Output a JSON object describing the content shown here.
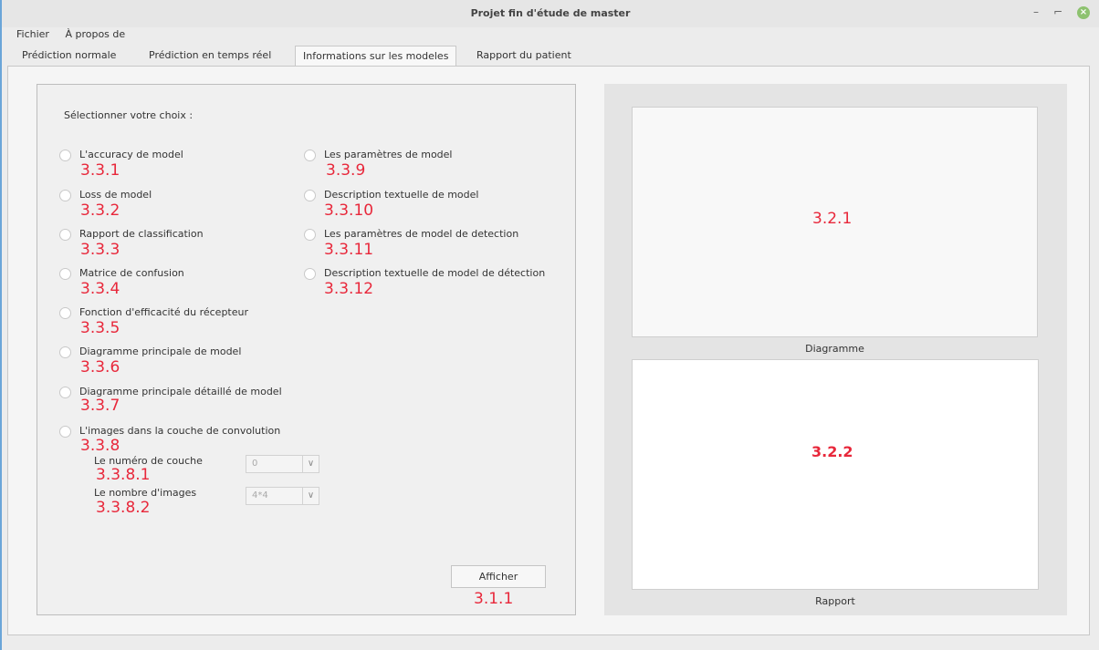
{
  "window": {
    "title": "Projet fin d'étude de master",
    "min": "–",
    "restore": "⌐",
    "close": "×"
  },
  "menu": [
    "Fichier",
    "À propos de"
  ],
  "tabs": [
    {
      "label": "Prédiction normale",
      "num": "1"
    },
    {
      "label": "Prédiction en temps réel",
      "num": "2"
    },
    {
      "label": "Informations sur les modeles",
      "num": "3",
      "active": true
    },
    {
      "label": "Rapport du patient",
      "num": "4"
    }
  ],
  "left": {
    "prompt": "Sélectionner votre choix :",
    "col1": [
      {
        "label": "L'accuracy de model",
        "code": "3.3.1"
      },
      {
        "label": "Loss de model",
        "code": "3.3.2"
      },
      {
        "label": "Rapport de classification",
        "code": "3.3.3"
      },
      {
        "label": "Matrice de confusion",
        "code": "3.3.4"
      },
      {
        "label": "Fonction d'efficacité du récepteur",
        "code": "3.3.5"
      },
      {
        "label": "Diagramme principale de model",
        "code": "3.3.6"
      },
      {
        "label": "Diagramme principale détaillé de  model",
        "code": "3.3.7"
      },
      {
        "label": "L'images dans la couche de convolution",
        "code": "3.3.8"
      }
    ],
    "col2": [
      {
        "label": "Les paramètres de model",
        "code": "3.3.9"
      },
      {
        "label": "Description textuelle de model",
        "code": "3.3.10"
      },
      {
        "label": "Les paramètres de model de detection",
        "code": "3.3.11"
      },
      {
        "label": "Description textuelle de model de détection",
        "code": "3.3.12"
      }
    ],
    "layer": {
      "label": "Le numéro de couche",
      "value": "0",
      "code": "3.3.8.1"
    },
    "images": {
      "label": "Le nombre d'images",
      "value": "4*4",
      "code": "3.3.8.2"
    },
    "button": {
      "label": "Afficher",
      "code": "3.1.1"
    }
  },
  "right": {
    "diagram": {
      "code": "3.2.1",
      "caption": "Diagramme"
    },
    "report": {
      "code": "3.2.2",
      "caption": "Rapport"
    }
  }
}
